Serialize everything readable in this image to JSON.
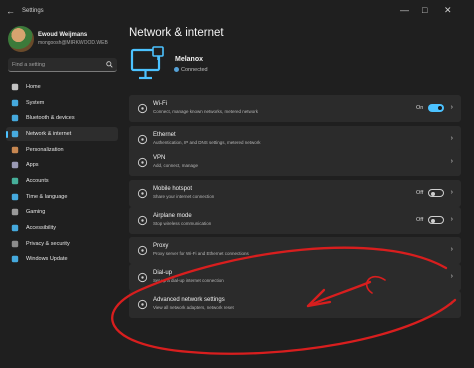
{
  "window": {
    "title": "Settings",
    "back_glyph": "←",
    "controls": [
      "—",
      "□",
      "✕"
    ]
  },
  "user": {
    "name": "Ewoud Weijmans",
    "email": "mongoosh@MIRKWOOD.WEB"
  },
  "search": {
    "placeholder": "Find a setting",
    "icon": "search-icon"
  },
  "sidebar": {
    "items": [
      {
        "label": "Home",
        "icon": "home-icon",
        "color": "#e0e0e0",
        "active": false
      },
      {
        "label": "System",
        "icon": "system-icon",
        "color": "#4cc2ff",
        "active": false
      },
      {
        "label": "Bluetooth & devices",
        "icon": "bluetooth-icon",
        "color": "#4cc2ff",
        "active": false
      },
      {
        "label": "Network & internet",
        "icon": "network-icon",
        "color": "#4cc2ff",
        "active": true
      },
      {
        "label": "Personalization",
        "icon": "brush-icon",
        "color": "#e59a5b",
        "active": false
      },
      {
        "label": "Apps",
        "icon": "apps-icon",
        "color": "#b0b0d0",
        "active": false
      },
      {
        "label": "Accounts",
        "icon": "accounts-icon",
        "color": "#4ec9b0",
        "active": false
      },
      {
        "label": "Time & language",
        "icon": "globe-icon",
        "color": "#4cc2ff",
        "active": false
      },
      {
        "label": "Gaming",
        "icon": "gaming-icon",
        "color": "#b0b0b0",
        "active": false
      },
      {
        "label": "Accessibility",
        "icon": "accessibility-icon",
        "color": "#4cc2ff",
        "active": false
      },
      {
        "label": "Privacy & security",
        "icon": "shield-icon",
        "color": "#a0a0a0",
        "active": false
      },
      {
        "label": "Windows Update",
        "icon": "update-icon",
        "color": "#4cc2ff",
        "active": false
      }
    ]
  },
  "main": {
    "title": "Network & internet",
    "network": {
      "name": "Melanox",
      "status": "Connected",
      "status_color": "#55a1d6"
    },
    "cards": [
      {
        "title": "Wi-Fi",
        "subtitle": "Connect, manage known networks, metered network",
        "icon": "wifi-icon",
        "state": "On",
        "toggle": "on",
        "chevron": "›"
      },
      {
        "title": "Ethernet",
        "subtitle": "Authentication, IP and DNS settings, metered network",
        "icon": "ethernet-icon",
        "state": null,
        "toggle": null,
        "chevron": "›"
      },
      {
        "title": "VPN",
        "subtitle": "Add, connect, manage",
        "icon": "vpn-icon",
        "state": null,
        "toggle": null,
        "chevron": "›"
      },
      {
        "title": "Mobile hotspot",
        "subtitle": "Share your internet connection",
        "icon": "hotspot-icon",
        "state": "Off",
        "toggle": "off",
        "chevron": "›"
      },
      {
        "title": "Airplane mode",
        "subtitle": "Stop wireless communication",
        "icon": "airplane-icon",
        "state": "Off",
        "toggle": "off",
        "chevron": "›"
      },
      {
        "title": "Proxy",
        "subtitle": "Proxy server for Wi-Fi and Ethernet connections",
        "icon": "proxy-icon",
        "state": null,
        "toggle": null,
        "chevron": "›"
      },
      {
        "title": "Dial-up",
        "subtitle": "Set up a dial-up internet connection",
        "icon": "dialup-icon",
        "state": null,
        "toggle": null,
        "chevron": "›"
      },
      {
        "title": "Advanced network settings",
        "subtitle": "View all network adapters, network reset",
        "icon": "advanced-network-icon",
        "state": null,
        "toggle": null,
        "chevron": "›"
      }
    ]
  },
  "annotation": {
    "color": "#d81e1e"
  }
}
